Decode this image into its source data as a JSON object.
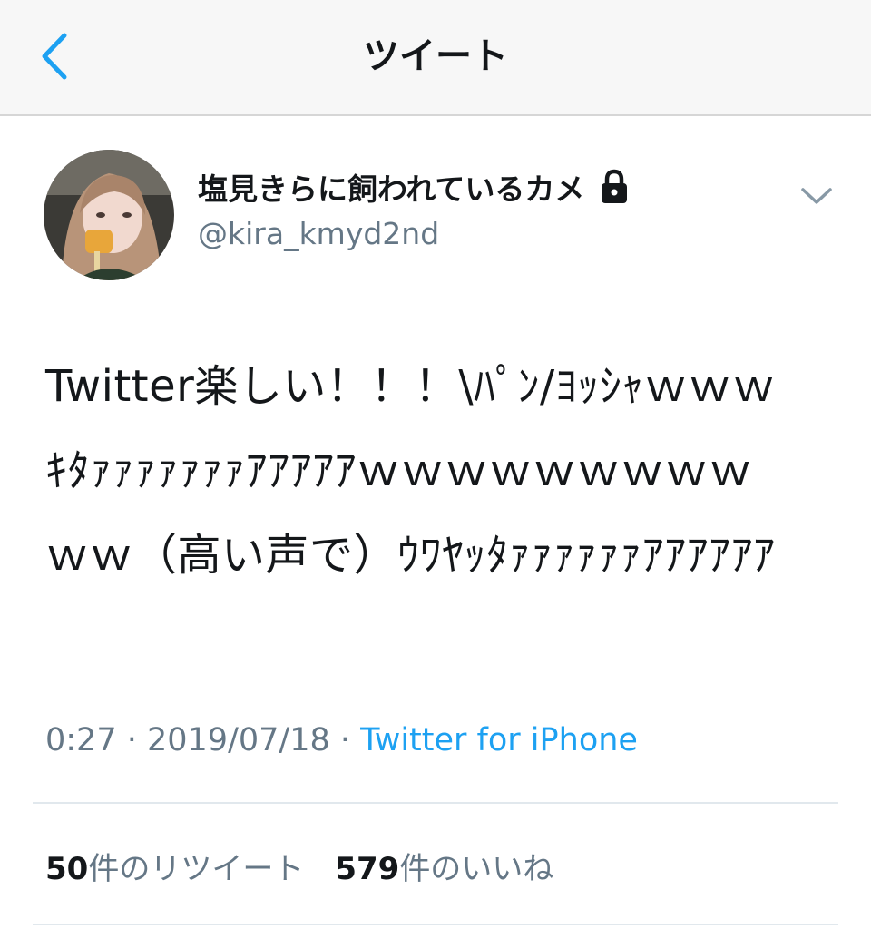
{
  "nav": {
    "title": "ツイート",
    "back_icon": "chevron-left-icon",
    "accent_color": "#1da1f2"
  },
  "author": {
    "display_name": "塩見きらに飼われているカメ",
    "handle": "@kira_kmyd2nd",
    "protected_icon": "lock-icon"
  },
  "tweet": {
    "text": "Twitter楽しい！！！\\ﾊﾟﾝ/ﾖｯｼｬｗｗｗｷﾀｧｧｧｧｧｧｧｱｱｱｱｱｗｗｗｗｗｗｗｗｗｗｗ（高い声で）ｳﾜﾔｯﾀｧｧｧｧｧｧｱｱｱｱｱｱ",
    "time": "0:27",
    "date": "2019/07/18",
    "separator": " · ",
    "source": "Twitter for iPhone"
  },
  "stats": {
    "retweets_count": "50",
    "retweets_label": "件のリツイート",
    "likes_count": "579",
    "likes_label": "件のいいね"
  }
}
